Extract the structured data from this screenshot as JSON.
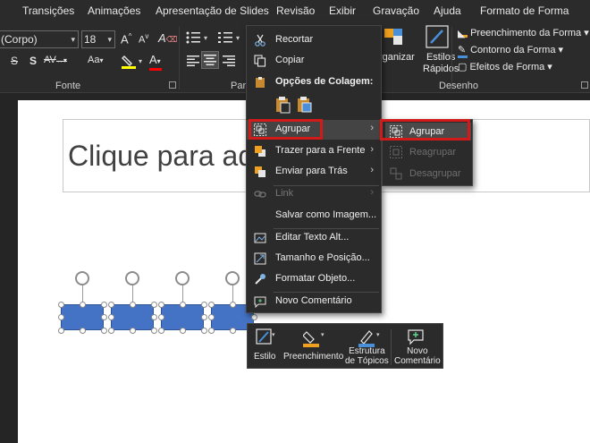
{
  "colors": {
    "ribbon_bg": "#2b2b2b",
    "accent_red": "#d11a1a",
    "shape_fill": "#4472c4",
    "highlight_yellow": "#ffff00",
    "font_color_red": "#ff0000"
  },
  "tabs": [
    "Transições",
    "Animações",
    "Apresentação de Slides",
    "Revisão",
    "Exibir",
    "Gravação",
    "Ajuda",
    "Formato de Forma"
  ],
  "font_group": {
    "font_name": "(Corpo)",
    "font_size": "18",
    "label": "Fonte",
    "grow_label": "A",
    "shrink_label": "A",
    "clear_label": "A",
    "strike_label": "S",
    "shadow_label": "S",
    "spacing_label": "AV",
    "case_label": "Aa",
    "fontcolor_label": "A"
  },
  "paragraph_group": {
    "label": "Pará"
  },
  "drawing_group": {
    "label": "Desenho",
    "organize_label": "rganizar",
    "quick_styles_label": [
      "Estilos",
      "Rápidos"
    ],
    "fill_label": "Preenchimento da Forma",
    "outline_label": "Contorno da Forma",
    "effects_label": "Efeitos de Forma"
  },
  "slide": {
    "title_placeholder": "Clique para ad"
  },
  "context_menu": {
    "cut": "Recortar",
    "copy": "Copiar",
    "paste_options": "Opções de Colagem:",
    "group": "Agrupar",
    "bring_front": "Trazer para a Frente",
    "send_back": "Enviar para Trás",
    "link": "Link",
    "save_image": "Salvar como Imagem...",
    "alt_text": "Editar Texto Alt...",
    "size_position": "Tamanho e Posição...",
    "format_object": "Formatar Objeto...",
    "new_comment": "Novo Comentário"
  },
  "group_submenu": {
    "group": "Agrupar",
    "regroup": "Reagrupar",
    "ungroup": "Desagrupar"
  },
  "mini_toolbar": {
    "style": "Estilo",
    "fill": "Preenchimento",
    "outline_1": "Estrutura",
    "outline_2": "de Tópicos",
    "comment_1": "Novo",
    "comment_2": "Comentário"
  }
}
